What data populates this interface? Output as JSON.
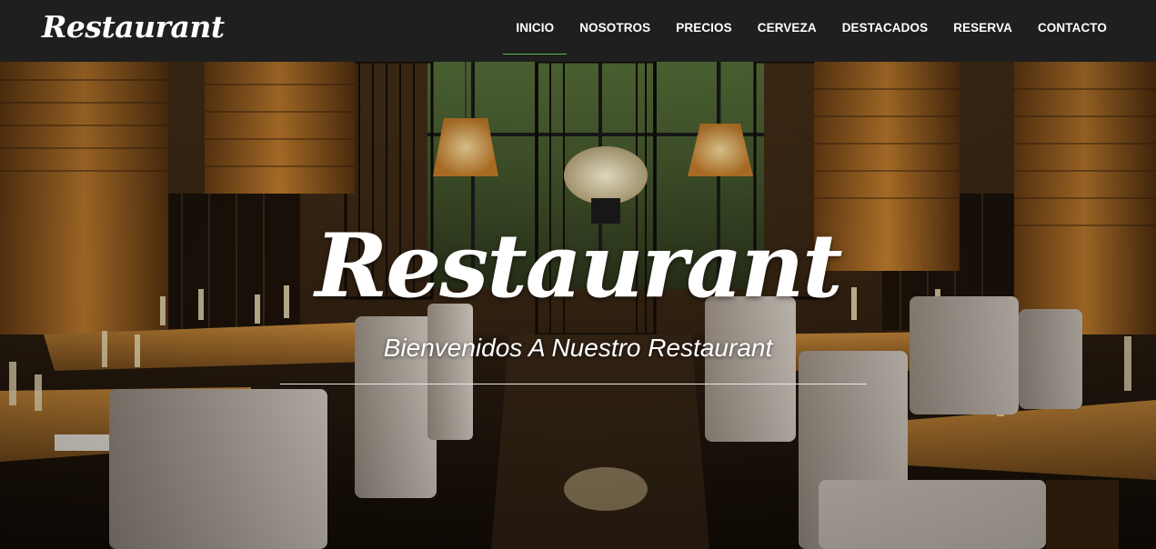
{
  "navbar": {
    "brand": "Restaurant",
    "items": [
      {
        "label": "INICIO",
        "active": true
      },
      {
        "label": "NOSOTROS",
        "active": false
      },
      {
        "label": "PRECIOS",
        "active": false
      },
      {
        "label": "CERVEZA",
        "active": false
      },
      {
        "label": "DESTACADOS",
        "active": false
      },
      {
        "label": "RESERVA",
        "active": false
      },
      {
        "label": "CONTACTO",
        "active": false
      }
    ],
    "active_indicator_color": "#5cb85c",
    "background_color": "#1f1f1f"
  },
  "hero": {
    "title": "Restaurant",
    "subtitle": "Bienvenidos A Nuestro Restaurant",
    "background_description_icon": "restaurant-interior-photo"
  }
}
